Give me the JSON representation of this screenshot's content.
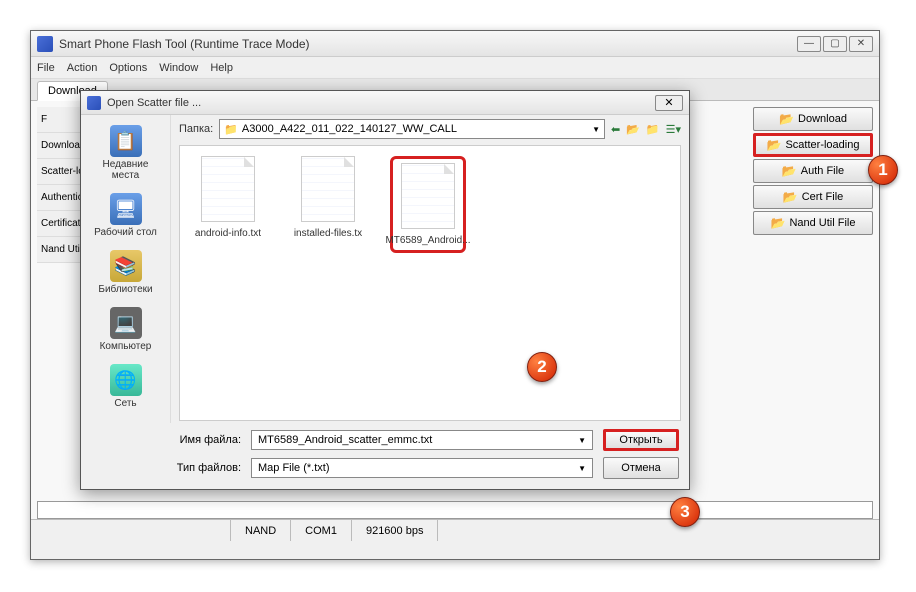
{
  "main": {
    "title": "Smart Phone Flash Tool (Runtime Trace Mode)",
    "menus": [
      "File",
      "Action",
      "Options",
      "Window",
      "Help"
    ],
    "tab": "Download",
    "left_rows": [
      "F",
      "Download",
      "Scatter-lo",
      "Authentica",
      "Certificatio",
      "Nand Util"
    ],
    "right_buttons": [
      {
        "label": "Download",
        "icon": "📂"
      },
      {
        "label": "Scatter-loading",
        "icon": "📂",
        "hl": true
      },
      {
        "label": "Auth File",
        "icon": "📂"
      },
      {
        "label": "Cert File",
        "icon": "📂"
      },
      {
        "label": "Nand Util File",
        "icon": "📂"
      }
    ],
    "status": [
      "",
      "NAND",
      "COM1",
      "921600 bps"
    ]
  },
  "dialog": {
    "title": "Open Scatter file ...",
    "folder_label": "Папка:",
    "folder_value": "A3000_A422_011_022_140127_WW_CALL",
    "places": [
      {
        "name": "Недавние места",
        "cls": "desk"
      },
      {
        "name": "Рабочий стол",
        "cls": "desk"
      },
      {
        "name": "Библиотеки",
        "cls": "lib"
      },
      {
        "name": "Компьютер",
        "cls": "comp"
      },
      {
        "name": "Сеть",
        "cls": "net"
      }
    ],
    "files": [
      {
        "name": "android-info.txt",
        "sel": false
      },
      {
        "name": "installed-files.tx",
        "sel": false
      },
      {
        "name": "MT6589_Android...",
        "sel": true
      }
    ],
    "filename_label": "Имя файла:",
    "filename_value": "MT6589_Android_scatter_emmc.txt",
    "filetype_label": "Тип файлов:",
    "filetype_value": "Map File (*.txt)",
    "open_btn": "Открыть",
    "cancel_btn": "Отмена"
  },
  "callouts": {
    "c1": "1",
    "c2": "2",
    "c3": "3"
  }
}
